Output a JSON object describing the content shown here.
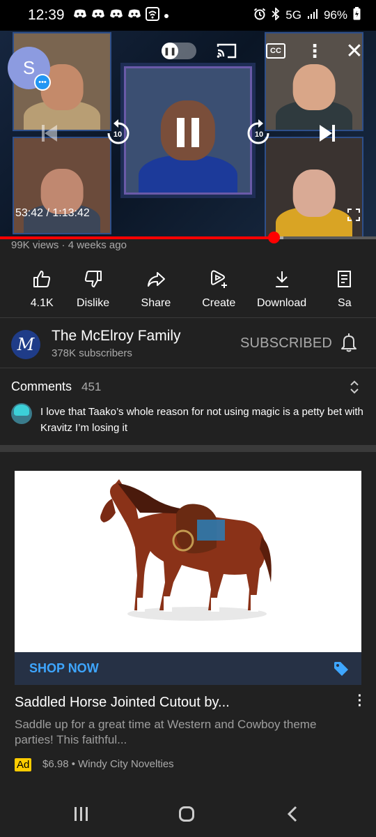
{
  "status_bar": {
    "time": "12:39",
    "network": "5G",
    "battery": "96%",
    "icons": [
      "discord-icon",
      "discord-icon",
      "discord-icon",
      "discord-icon",
      "wifi-icon",
      "dot-icon",
      "alarm-icon",
      "bluetooth-icon",
      "signal-icon",
      "battery-icon"
    ]
  },
  "player": {
    "avatar_letter": "S",
    "elapsed": "53:42",
    "duration": "1:13:42",
    "time_display": "53:42 / 1:13:42",
    "rewind_seconds": "10",
    "forward_seconds": "10",
    "progress_fraction": 0.728,
    "colors": {
      "progress": "#ff0000",
      "accent": "#3ea6ff"
    }
  },
  "meta": {
    "views_and_date": "99K views · 4 weeks ago"
  },
  "actions": [
    {
      "icon": "thumbs-up-icon",
      "label": "4.1K"
    },
    {
      "icon": "thumbs-down-icon",
      "label": "Dislike"
    },
    {
      "icon": "share-icon",
      "label": "Share"
    },
    {
      "icon": "create-icon",
      "label": "Create"
    },
    {
      "icon": "download-icon",
      "label": "Download"
    },
    {
      "icon": "save-icon",
      "label": "Sa"
    }
  ],
  "channel": {
    "logo_letter": "M",
    "name": "The McElroy Family",
    "subscribers": "378K subscribers",
    "subscribe_state": "SUBSCRIBED"
  },
  "comments": {
    "title": "Comments",
    "count": "451",
    "top_comment": "I love that Taako’s whole reason for not using magic is a petty bet with Kravitz I’m losing it"
  },
  "ad": {
    "cta": "SHOP NOW",
    "title": "Saddled Horse Jointed Cutout by...",
    "description": "Saddle up for a great time at Western and Cowboy theme parties! This faithful...",
    "badge": "Ad",
    "price_line": "$6.98 • Windy City Novelties"
  }
}
